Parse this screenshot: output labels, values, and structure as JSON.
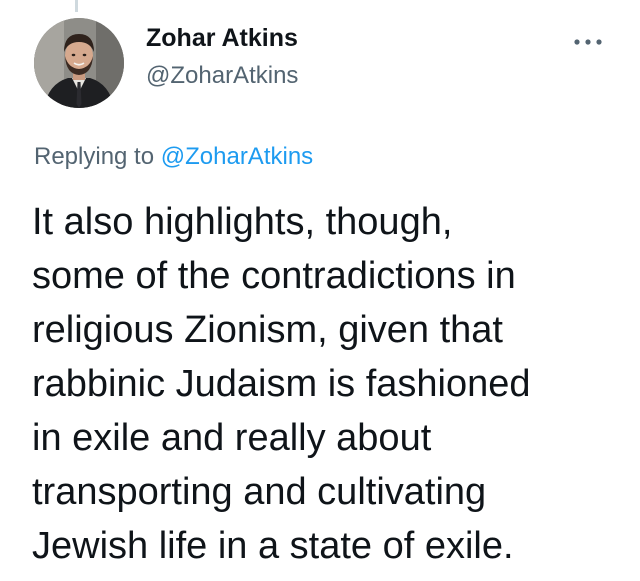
{
  "author": {
    "name": "Zohar Atkins",
    "handle": "@ZoharAtkins",
    "avatar_icon": "profile-photo"
  },
  "reply": {
    "prefix": "Replying to ",
    "mention": "@ZoharAtkins"
  },
  "tweet": {
    "lines": [
      "It also highlights, though,",
      "some of the contradictions in",
      "religious Zionism, given that",
      "rabbinic Judaism is fashioned",
      "in exile and really about",
      "transporting and cultivating",
      "Jewish life in a state of exile."
    ]
  },
  "colors": {
    "text": "#0f1419",
    "secondary": "#536471",
    "link": "#1d9bf0",
    "thread_line": "#cfd9de"
  },
  "icons": {
    "more": "more-horizontal-icon"
  }
}
